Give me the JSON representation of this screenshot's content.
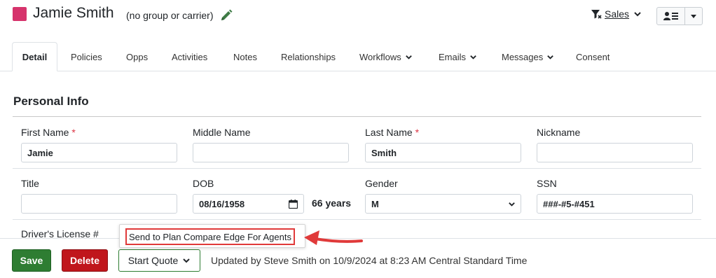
{
  "header": {
    "contact_name": "Jamie Smith",
    "group_text": "(no group or carrier)",
    "pipeline_filter": "Sales",
    "swatch_color": "#d6336c",
    "edit_icon": "pencil-icon"
  },
  "tabs": [
    {
      "label": "Detail",
      "active": true,
      "dropdown": false
    },
    {
      "label": "Policies",
      "active": false,
      "dropdown": false
    },
    {
      "label": "Opps",
      "active": false,
      "dropdown": false
    },
    {
      "label": "Activities",
      "active": false,
      "dropdown": false
    },
    {
      "label": "Notes",
      "active": false,
      "dropdown": false
    },
    {
      "label": "Relationships",
      "active": false,
      "dropdown": false
    },
    {
      "label": "Workflows",
      "active": false,
      "dropdown": true
    },
    {
      "label": "Emails",
      "active": false,
      "dropdown": true
    },
    {
      "label": "Messages",
      "active": false,
      "dropdown": true
    },
    {
      "label": "Consent",
      "active": false,
      "dropdown": false
    }
  ],
  "personal_info": {
    "title": "Personal Info",
    "first_name": {
      "label": "First Name",
      "required": "*",
      "value": "Jamie"
    },
    "middle_name": {
      "label": "Middle Name",
      "value": ""
    },
    "last_name": {
      "label": "Last Name",
      "required": "*",
      "value": "Smith"
    },
    "nickname": {
      "label": "Nickname",
      "value": ""
    },
    "title_field": {
      "label": "Title",
      "value": ""
    },
    "dob": {
      "label": "DOB",
      "value": "08/16/1958",
      "age": "66 years"
    },
    "gender": {
      "label": "Gender",
      "value": "M"
    },
    "ssn": {
      "label": "SSN",
      "value": "###-#5-#451"
    },
    "drivers_license": {
      "label": "Driver's License #"
    }
  },
  "quote_menu": {
    "item": "Send to Plan Compare Edge For Agents",
    "highlight_color": "#e03a3a"
  },
  "footer": {
    "save_label": "Save",
    "delete_label": "Delete",
    "start_quote_label": "Start Quote",
    "updated_text": "Updated by Steve Smith on 10/9/2024 at 8:23 AM Central Standard Time"
  },
  "colors": {
    "save": "#2e7d32",
    "delete": "#c0161c",
    "required": "#dc3545"
  }
}
